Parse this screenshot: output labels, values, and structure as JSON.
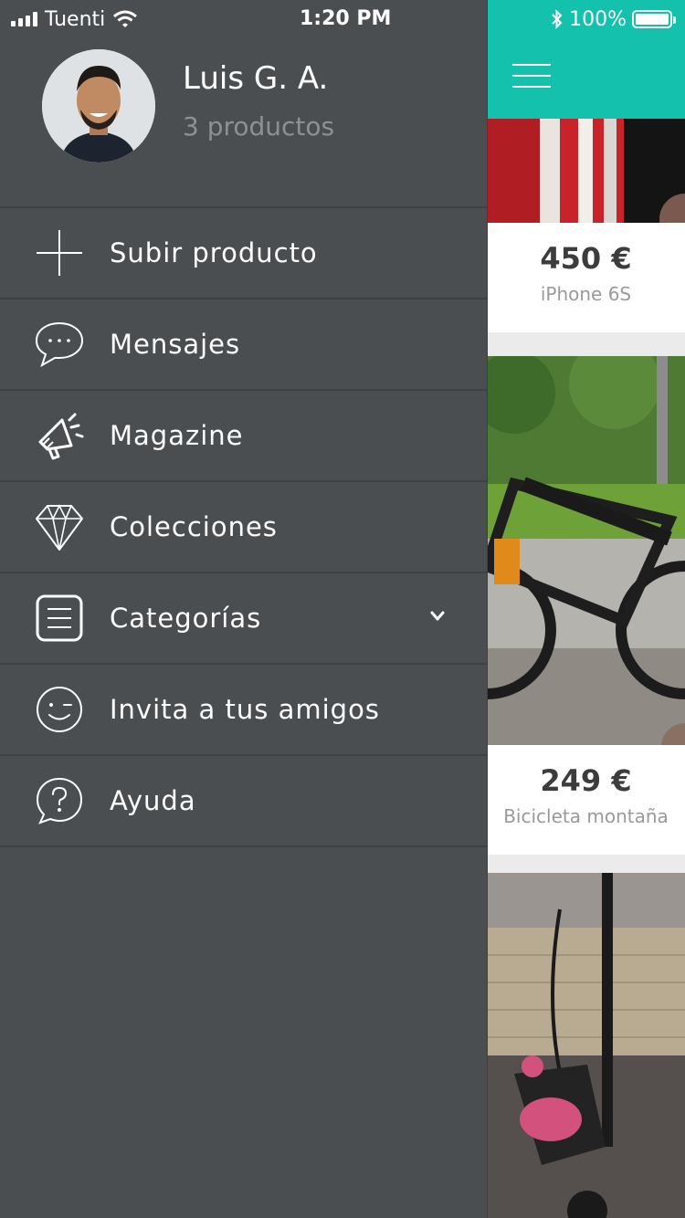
{
  "status": {
    "carrier": "Tuenti",
    "time": "1:20 PM",
    "battery": "100%"
  },
  "profile": {
    "name": "Luis G. A.",
    "products": "3 productos"
  },
  "menu": [
    {
      "label": "Subir producto",
      "icon": "plus-icon"
    },
    {
      "label": "Mensajes",
      "icon": "chat-bubble-icon"
    },
    {
      "label": "Magazine",
      "icon": "megaphone-icon"
    },
    {
      "label": "Colecciones",
      "icon": "diamond-icon"
    },
    {
      "label": "Categorías",
      "icon": "list-icon",
      "expandable": true
    },
    {
      "label": "Invita a tus amigos",
      "icon": "smiley-icon"
    },
    {
      "label": "Ayuda",
      "icon": "help-bubble-icon"
    }
  ],
  "listings": [
    {
      "price": "450 €",
      "title": "iPhone 6S"
    },
    {
      "price": "249 €",
      "title": "Bicicleta montaña"
    }
  ],
  "colors": {
    "brand": "#13c1ac",
    "drawer_bg": "#4b4e51",
    "divider": "#3f4245"
  }
}
